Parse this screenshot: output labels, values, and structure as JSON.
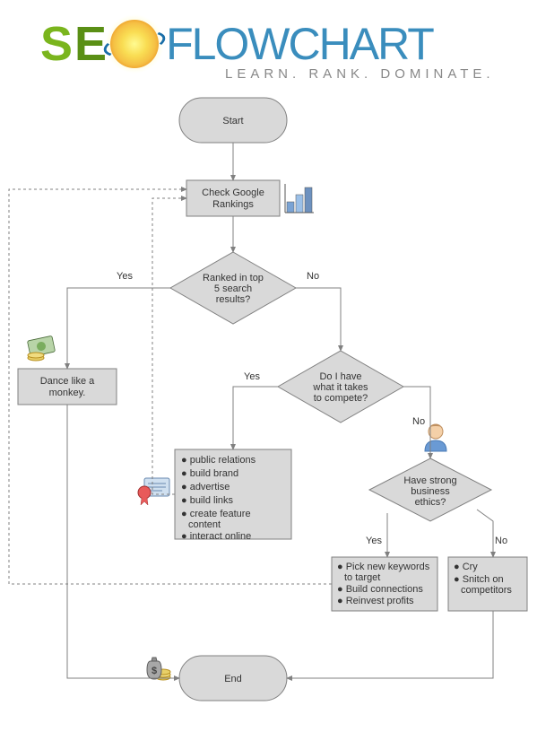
{
  "logo": {
    "seo": "SEO",
    "flowchart": "FLOWCHART",
    "tagline": "LEARN. RANK. DOMINATE."
  },
  "nodes": {
    "start": "Start",
    "check": "Check Google\nRankings",
    "ranked": "Ranked in top\n5 search\nresults?",
    "dance": "Dance like a\nmonkey.",
    "compete": "Do I have\nwhat it takes\nto compete?",
    "actions": [
      "public relations",
      "build brand",
      "advertise",
      "build links",
      "create feature content",
      "interact online"
    ],
    "ethics": "Have strong\nbusiness\nethics?",
    "yesEthics": [
      "Pick new keywords to target",
      "Build connections",
      "Reinvest profits"
    ],
    "noEthics": [
      "Cry",
      "Snitch on competitors"
    ],
    "end": "End"
  },
  "labels": {
    "yes": "Yes",
    "no": "No"
  },
  "icons": {
    "chart": "bar-chart-icon",
    "money": "money-icon",
    "cert": "certificate-icon",
    "person": "person-icon",
    "moneybag": "moneybag-icon"
  }
}
